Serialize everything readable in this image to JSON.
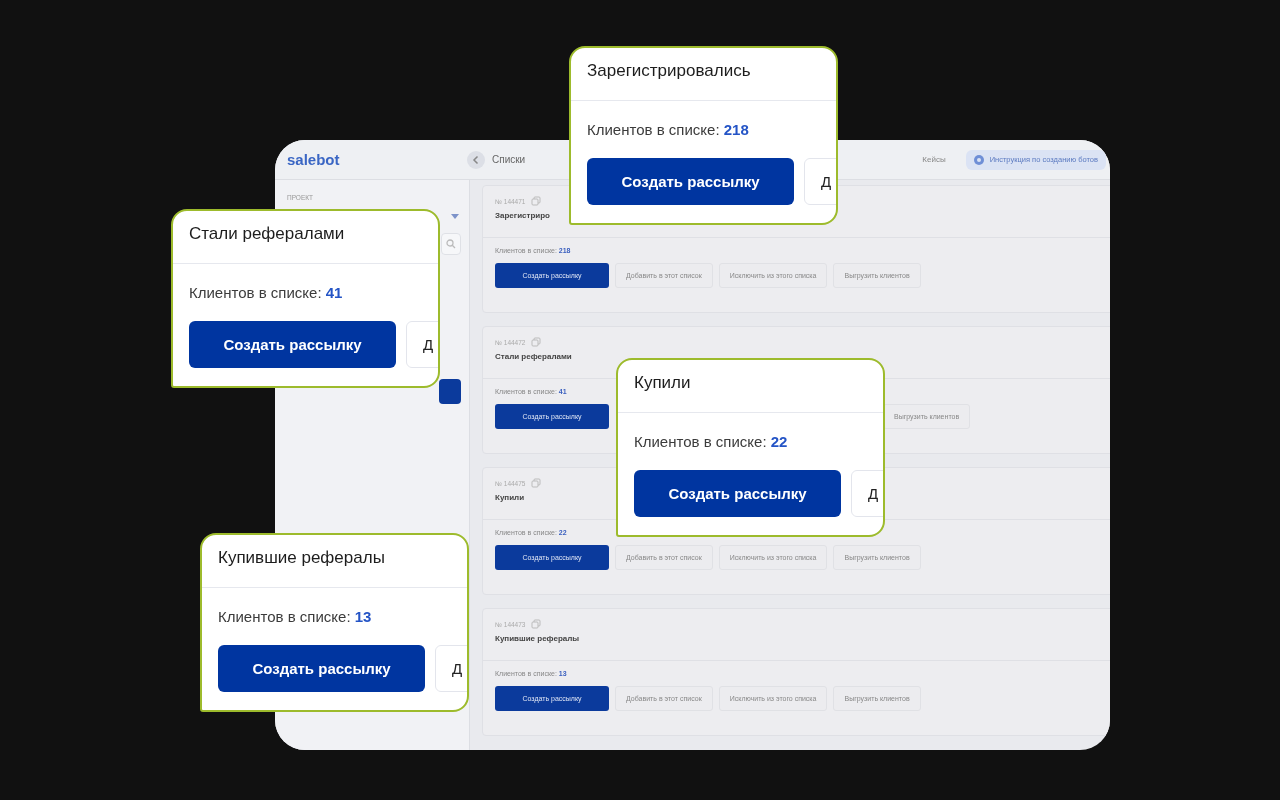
{
  "backdrop": {
    "logo": "salebot",
    "page_title": "Списки",
    "nav_link": "Кейсы",
    "guide_button": "Инструкция по созданию ботов",
    "sidebar": {
      "project_label": "ПРОЕКТ"
    },
    "lists": [
      {
        "number": "№ 144471",
        "title": "Зарегистриро",
        "count_label": "Клиентов в списке:",
        "count": "218",
        "buttons": [
          {
            "kind": "primary",
            "label": "Создать рассылку"
          },
          {
            "kind": "secondary",
            "label": "Добавить в этот список"
          },
          {
            "kind": "secondary",
            "label": "Исключить из этого списка"
          },
          {
            "kind": "secondary",
            "label": "Выгрузить клиентов"
          }
        ]
      },
      {
        "number": "№ 144472",
        "title": "Стали рефералами",
        "count_label": "Клиентов в списке:",
        "count": "41",
        "buttons": [
          {
            "kind": "primary",
            "label": "Создать рассылку"
          },
          {
            "kind": "covered"
          },
          {
            "kind": "secondary",
            "label": "Выгрузить клиентов"
          }
        ]
      },
      {
        "number": "№ 144475",
        "title": "Купили",
        "count_label": "Клиентов в списке:",
        "count": "22",
        "buttons": [
          {
            "kind": "primary",
            "label": "Создать рассылку"
          },
          {
            "kind": "secondary",
            "label": "Добавить в этот список"
          },
          {
            "kind": "secondary",
            "label": "Исключить из этого списка"
          },
          {
            "kind": "secondary",
            "label": "Выгрузить клиентов"
          }
        ]
      },
      {
        "number": "№ 144473",
        "title": "Купившие рефералы",
        "count_label": "Клиентов в списке:",
        "count": "13",
        "buttons": [
          {
            "kind": "primary",
            "label": "Создать рассылку"
          },
          {
            "kind": "secondary",
            "label": "Добавить в этот список"
          },
          {
            "kind": "secondary",
            "label": "Исключить из этого списка"
          },
          {
            "kind": "secondary",
            "label": "Выгрузить клиентов"
          }
        ]
      }
    ]
  },
  "callouts": [
    {
      "title": "Зарегистрировались",
      "count_label": "Клиентов в списке:",
      "count": "218",
      "primary_button": "Создать рассылку",
      "secondary_button": "Д"
    },
    {
      "title": "Стали рефералами",
      "count_label": "Клиентов в списке:",
      "count": "41",
      "primary_button": "Создать рассылку",
      "secondary_button": "Д"
    },
    {
      "title": "Купили",
      "count_label": "Клиентов в списке:",
      "count": "22",
      "primary_button": "Создать рассылку",
      "secondary_button": "Д"
    },
    {
      "title": "Купившие рефералы",
      "count_label": "Клиентов в списке:",
      "count": "13",
      "primary_button": "Создать рассылку",
      "secondary_button": "Д"
    }
  ]
}
